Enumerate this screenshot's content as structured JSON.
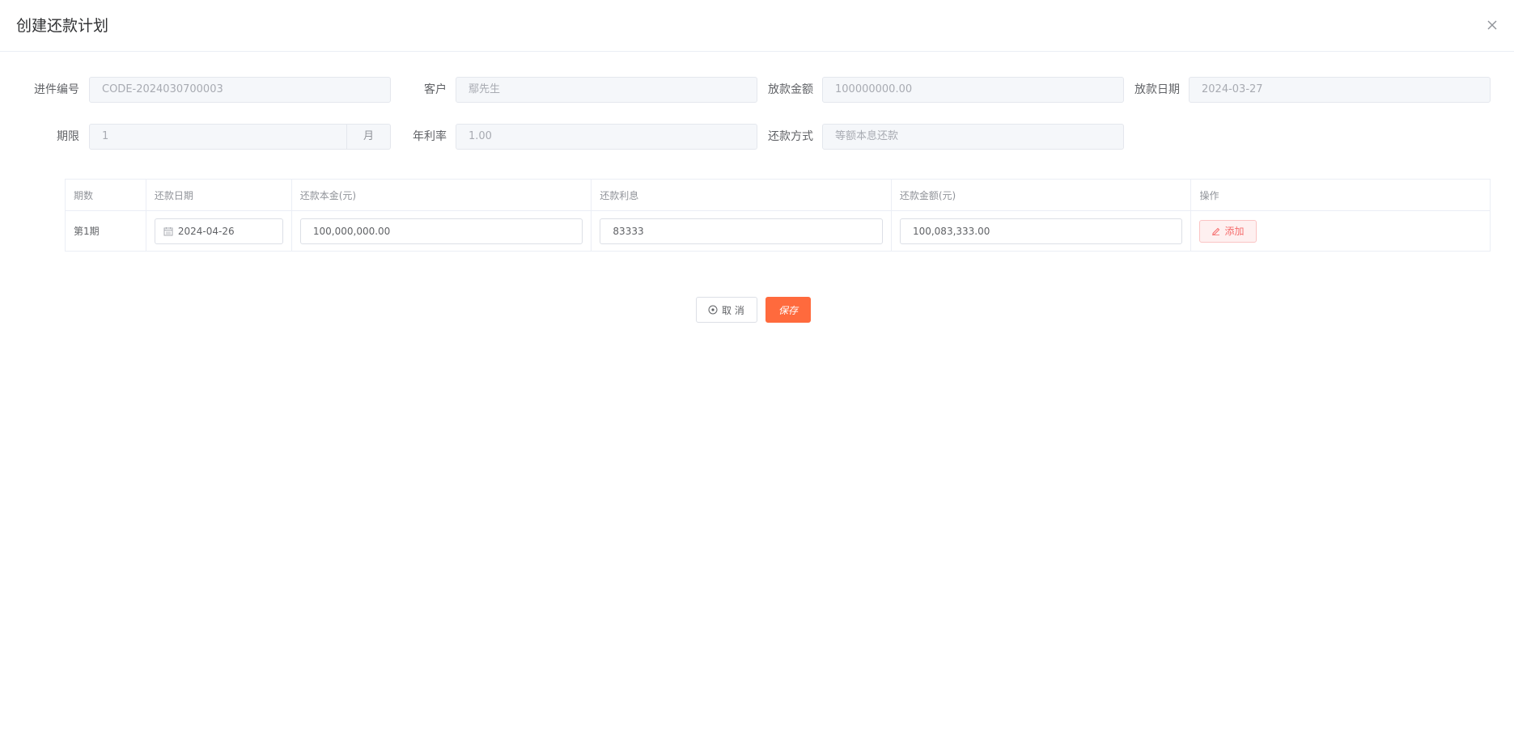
{
  "dialog": {
    "title": "创建还款计划"
  },
  "form": {
    "row1": {
      "case_no": {
        "label": "进件编号",
        "value": "CODE-2024030700003"
      },
      "customer": {
        "label": "客户",
        "value": "鄢先生"
      },
      "loan_amount": {
        "label": "放款金额",
        "value": "100000000.00"
      },
      "loan_date": {
        "label": "放款日期",
        "value": "2024-03-27"
      }
    },
    "row2": {
      "term": {
        "label": "期限",
        "value": "1",
        "unit": "月"
      },
      "annual_rate": {
        "label": "年利率",
        "value": "1.00"
      },
      "repay_method": {
        "label": "还款方式",
        "placeholder": "等额本息还款"
      }
    }
  },
  "table": {
    "headers": [
      "期数",
      "还款日期",
      "还款本金(元)",
      "还款利息",
      "还款金额(元)",
      "操作"
    ],
    "rows": [
      {
        "period": "第1期",
        "date": "2024-04-26",
        "principal": "100,000,000.00",
        "interest": "83333",
        "amount": "100,083,333.00",
        "action": "添加"
      }
    ]
  },
  "footer": {
    "cancel_label": "取 消",
    "save_label": "保存"
  },
  "colors": {
    "primary": "#ff6a3d",
    "danger": "#f56c6c"
  }
}
